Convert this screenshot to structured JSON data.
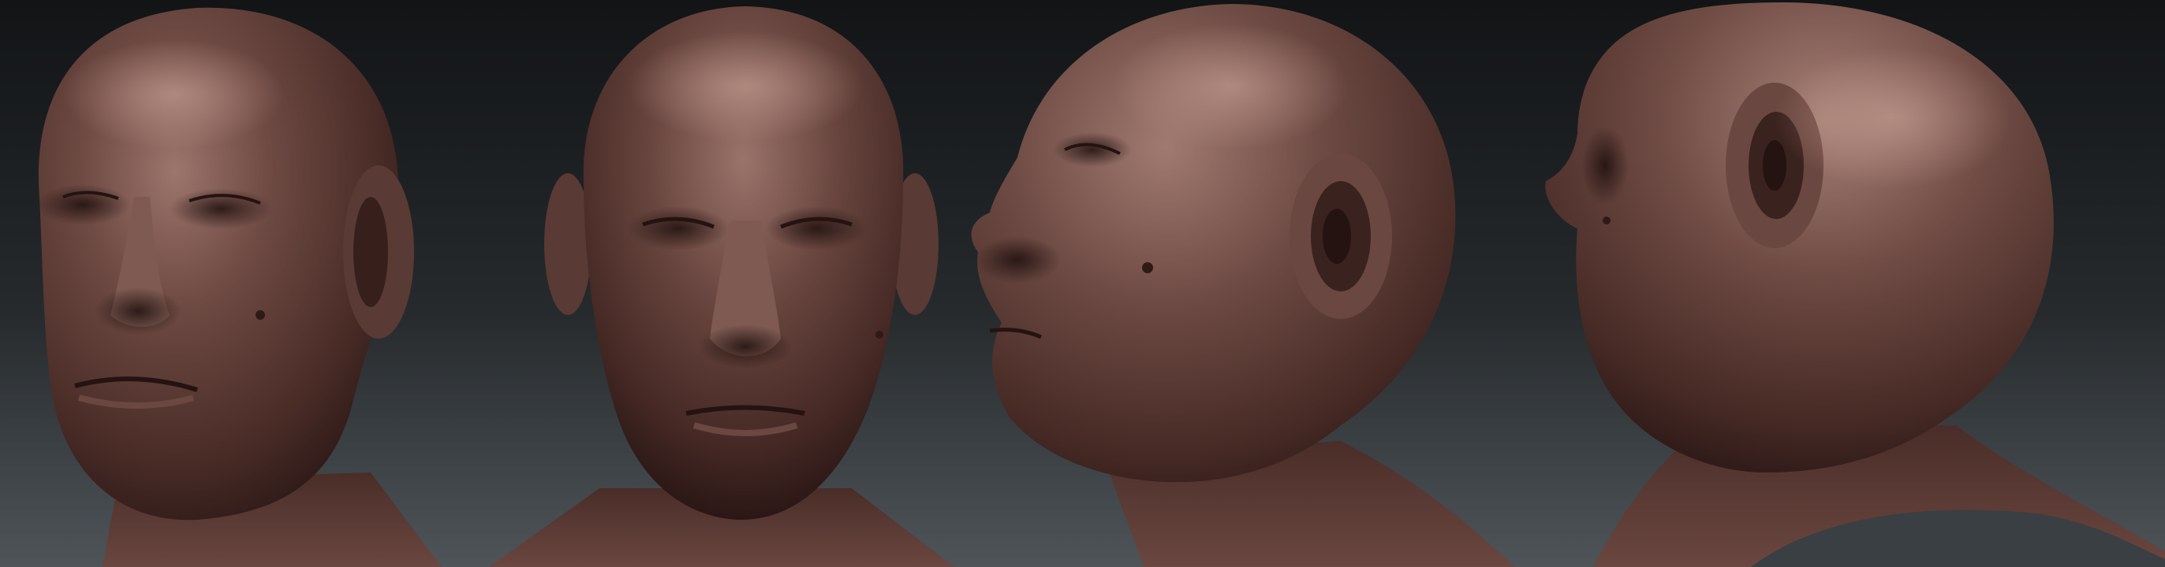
{
  "scene": {
    "background_top": "#121416",
    "background_bottom": "#4e5458",
    "clay_dark": "#2e1a17",
    "clay_mid": "#5a3a34",
    "clay_light": "#8a655d",
    "clay_highlight": "#b08a80",
    "shirt_color": "#3a3f43"
  },
  "views": [
    {
      "name": "three-quarter-left"
    },
    {
      "name": "front"
    },
    {
      "name": "profile-left"
    },
    {
      "name": "back-three-quarter"
    }
  ]
}
